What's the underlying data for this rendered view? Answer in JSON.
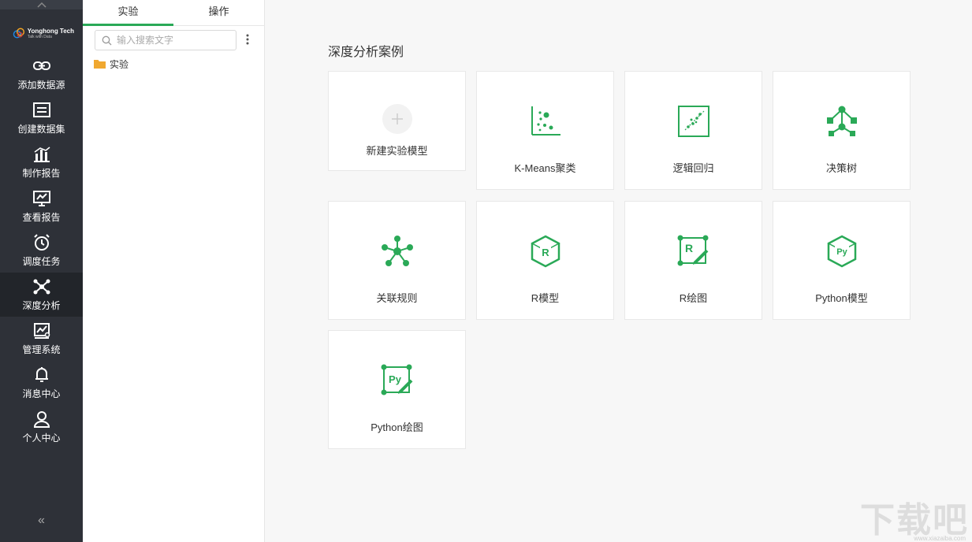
{
  "brand": {
    "name": "Yonghong Tech",
    "tagline": "Talk with Data"
  },
  "nav": {
    "items": [
      {
        "label": "添加数据源",
        "icon": "link-icon"
      },
      {
        "label": "创建数据集",
        "icon": "dataset-icon"
      },
      {
        "label": "制作报告",
        "icon": "bar-chart-icon"
      },
      {
        "label": "查看报告",
        "icon": "presentation-icon"
      },
      {
        "label": "调度任务",
        "icon": "alarm-clock-icon"
      },
      {
        "label": "深度分析",
        "icon": "network-icon",
        "active": true
      },
      {
        "label": "管理系统",
        "icon": "admin-chart-icon"
      },
      {
        "label": "消息中心",
        "icon": "bell-icon"
      },
      {
        "label": "个人中心",
        "icon": "user-icon"
      }
    ],
    "collapse": "«"
  },
  "panel": {
    "tabs": [
      {
        "label": "实验",
        "active": true
      },
      {
        "label": "操作"
      }
    ],
    "search_placeholder": "输入搜索文字",
    "tree": [
      {
        "label": "实验",
        "icon": "folder-icon"
      }
    ]
  },
  "main": {
    "title": "深度分析案例",
    "cards": [
      {
        "label": "新建实验模型",
        "icon": "add-icon"
      },
      {
        "label": "K-Means聚类",
        "icon": "scatter-icon"
      },
      {
        "label": "逻辑回归",
        "icon": "regression-icon"
      },
      {
        "label": "决策树",
        "icon": "decision-tree-icon"
      },
      {
        "label": "关联规则",
        "icon": "association-icon"
      },
      {
        "label": "R模型",
        "icon": "r-model-icon"
      },
      {
        "label": "R绘图",
        "icon": "r-plot-icon"
      },
      {
        "label": "Python模型",
        "icon": "python-model-icon"
      },
      {
        "label": "Python绘图",
        "icon": "python-plot-icon"
      }
    ]
  },
  "accent_color": "#2aa957",
  "watermark": {
    "text": "下载吧",
    "url": "www.xiazaiba.com"
  }
}
